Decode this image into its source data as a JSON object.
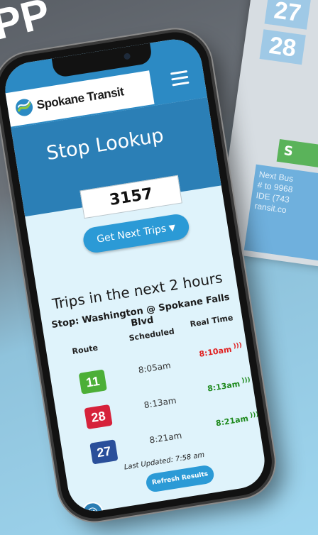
{
  "background": {
    "heading": "PP",
    "sign_numbers": [
      "27",
      "28"
    ],
    "green_label": "S",
    "note_lines": [
      "Next Bus",
      "# to 9968",
      "IDE (743",
      "ransit.co"
    ]
  },
  "app": {
    "logo_text": "Spokane Transit",
    "menu_icon": "hamburger-menu-icon"
  },
  "page": {
    "title": "Stop Lookup"
  },
  "stop_input": {
    "value": "3157"
  },
  "get_trips_button": {
    "label": "Get Next Trips",
    "icon": "map-pin-icon"
  },
  "results": {
    "heading": "Trips in the next 2 hours",
    "stop_name": "Stop: Washington @ Spokane Falls Blvd",
    "columns": [
      "Route",
      "Scheduled",
      "Real Time"
    ],
    "rows": [
      {
        "route": "11",
        "route_color": "#4caf37",
        "scheduled": "8:05am",
        "realtime": "8:10am",
        "realtime_color": "#e02020"
      },
      {
        "route": "28",
        "route_color": "#d6223b",
        "scheduled": "8:13am",
        "realtime": "8:13am",
        "realtime_color": "#1f8a1f"
      },
      {
        "route": "27",
        "route_color": "#2a4f9a",
        "scheduled": "8:21am",
        "realtime": "8:21am",
        "realtime_color": "#1f8a1f"
      }
    ],
    "last_updated": "Last Updated: 7:58 am",
    "refresh_label": "Refresh Results"
  },
  "accessibility": {
    "icon": "accessibility-icon"
  }
}
